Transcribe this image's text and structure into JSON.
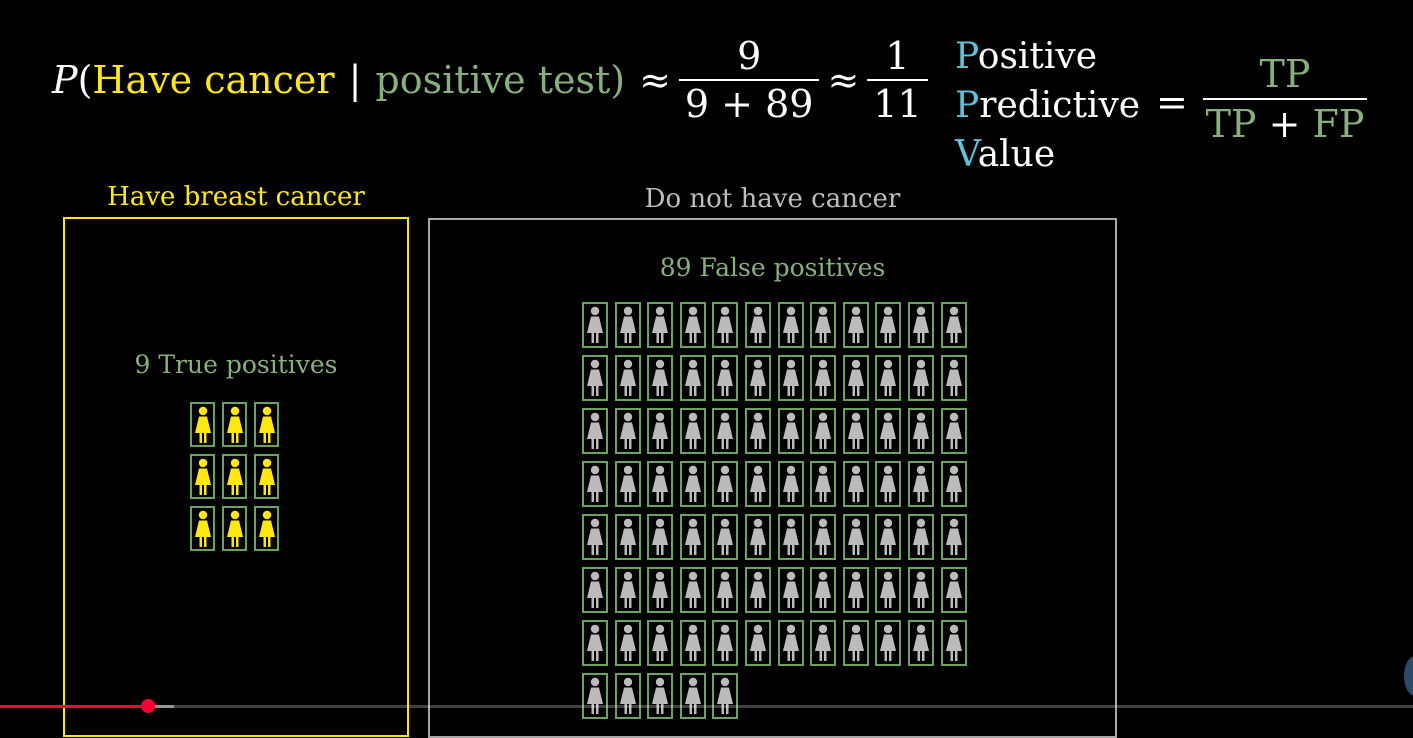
{
  "formula": {
    "p": "P",
    "open": "(",
    "event": "Have cancer",
    "given": "|",
    "condition": "positive test)",
    "approx1": "≈",
    "frac1_num": "9",
    "frac1_den": "9 + 89",
    "approx2": "≈",
    "frac2_num": "1",
    "frac2_den": "11"
  },
  "ppv": {
    "words": [
      {
        "initial": "P",
        "rest": "ositive"
      },
      {
        "initial": "P",
        "rest": "redictive"
      },
      {
        "initial": "V",
        "rest": "alue"
      }
    ],
    "equals": "=",
    "numerator": "TP",
    "denominator_a": "TP",
    "denominator_plus": " + ",
    "denominator_b": "FP"
  },
  "groups": {
    "cancer": {
      "box_label": "Have breast cancer",
      "label": "9 True positives",
      "count": 9
    },
    "no_cancer": {
      "box_label": "Do not have cancer",
      "label": "89 False positives",
      "count": 89
    }
  },
  "colors": {
    "yellow": "#ffe80a",
    "green": "#88b07a",
    "blue": "#58c4dd",
    "grey_person": "#bbbbbb",
    "red_progress": "#ff0033"
  },
  "video": {
    "progress": 0.105,
    "buffered": 0.123
  }
}
